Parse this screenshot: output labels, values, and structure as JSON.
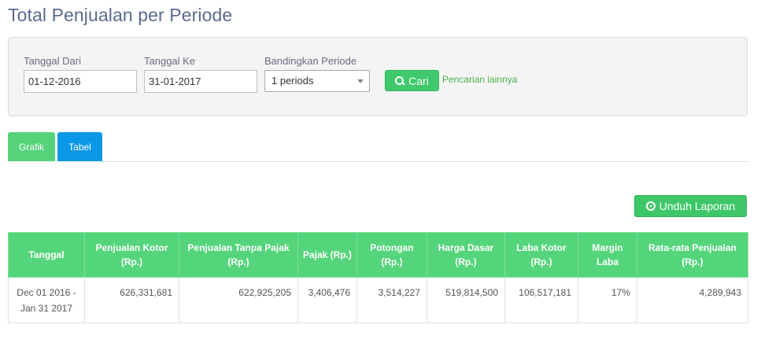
{
  "page_title": "Total Penjualan per Periode",
  "filters": {
    "tanggal_dari_label": "Tanggal Dari",
    "tanggal_dari_value": "01-12-2016",
    "tanggal_ke_label": "Tanggal Ke",
    "tanggal_ke_value": "31-01-2017",
    "bandingkan_label": "Bandingkan Periode",
    "bandingkan_value": "1 periods",
    "search_button_label": "Cari",
    "more_search_link": "Pencarian lainnya"
  },
  "tabs": [
    {
      "label": "Grafik"
    },
    {
      "label": "Tabel"
    }
  ],
  "download_button_label": "Unduh Laporan",
  "table": {
    "headers": [
      "Tanggal",
      "Penjualan Kotor (Rp.)",
      "Penjualan Tanpa Pajak (Rp.)",
      "Pajak (Rp.)",
      "Potongan (Rp.)",
      "Harga Dasar (Rp.)",
      "Laba Kotor (Rp.)",
      "Margin Laba",
      "Rata-rata Penjualan (Rp.)"
    ],
    "rows": [
      [
        "Dec 01 2016 - Jan 31 2017",
        "626,331,681",
        "622,925,205",
        "3,406,476",
        "3,514,227",
        "519,814,500",
        "106,517,181",
        "17%",
        "4,289,943"
      ]
    ]
  },
  "colors": {
    "accent_green": "#55d57b",
    "tab_active_blue": "#0b97e8",
    "title_color": "#5a6a8f"
  }
}
